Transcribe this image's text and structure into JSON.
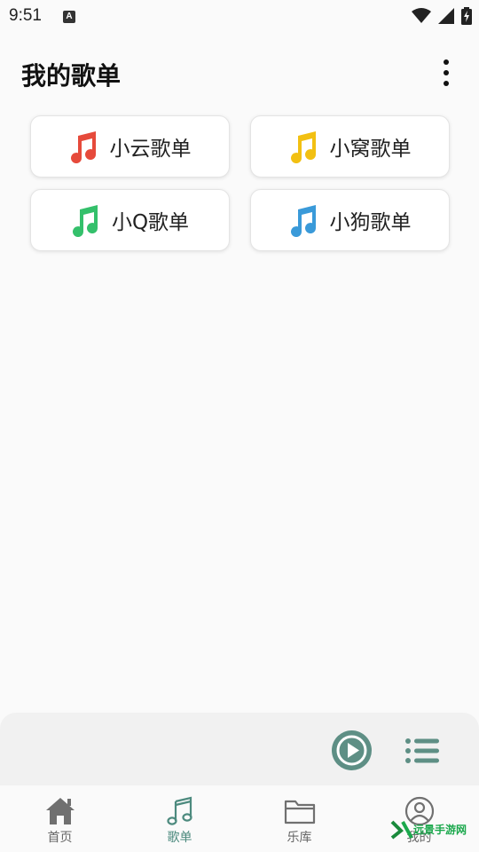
{
  "status_bar": {
    "time": "9:51",
    "notification_badge": "A"
  },
  "header": {
    "title": "我的歌单",
    "menu_icon": "more-vertical-icon"
  },
  "playlists": [
    {
      "label": "小云歌单",
      "icon": "music-note-icon",
      "color": "#e64a3b"
    },
    {
      "label": "小窝歌单",
      "icon": "music-note-icon",
      "color": "#f2c012"
    },
    {
      "label": "小Q歌单",
      "icon": "music-note-icon",
      "color": "#34c06b"
    },
    {
      "label": "小狗歌单",
      "icon": "music-note-icon",
      "color": "#3a9ad9"
    }
  ],
  "player": {
    "play_icon": "play-icon",
    "queue_icon": "playlist-icon",
    "accent": "#5e8f85"
  },
  "nav": {
    "active_color": "#4c8a7e",
    "items": [
      {
        "label": "首页",
        "icon": "home-icon"
      },
      {
        "label": "歌单",
        "icon": "music-note-icon",
        "active": true
      },
      {
        "label": "乐库",
        "icon": "folder-icon"
      },
      {
        "label": "我的",
        "icon": "user-icon"
      }
    ]
  },
  "watermark": {
    "text": "远景手游网"
  }
}
